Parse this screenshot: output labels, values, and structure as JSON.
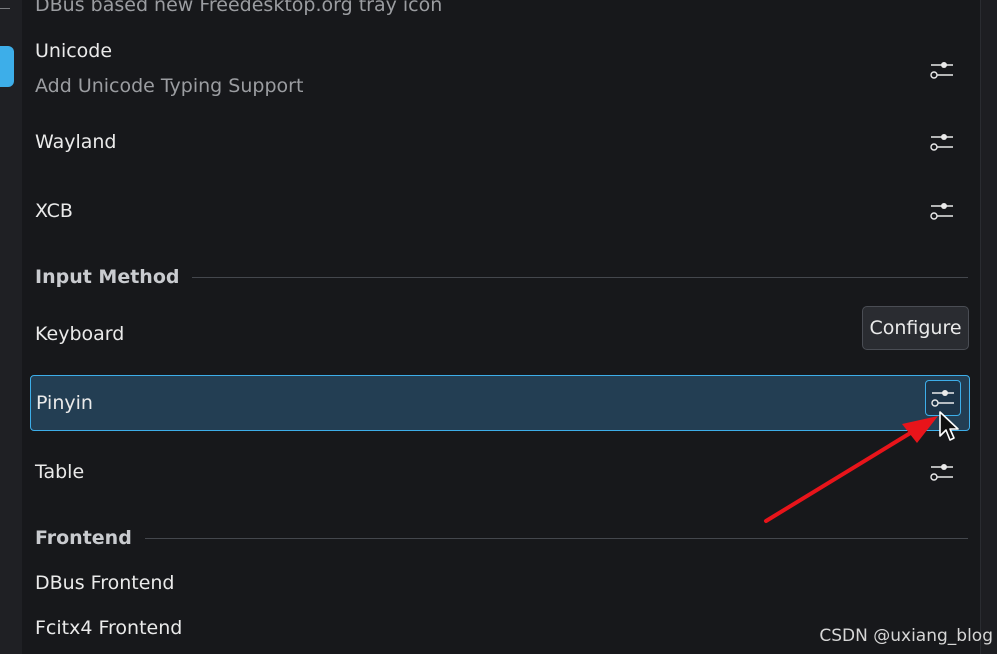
{
  "top_cut_description": "DBus based new Freedesktop.org tray icon",
  "addons": [
    {
      "name": "Unicode",
      "description": "Add Unicode Typing Support",
      "icon": "configure-icon"
    },
    {
      "name": "Wayland",
      "icon": "configure-icon"
    },
    {
      "name": "XCB",
      "icon": "configure-icon"
    }
  ],
  "input_method_section": {
    "title": "Input Method",
    "items": [
      {
        "name": "Keyboard"
      },
      {
        "name": "Pinyin",
        "selected": true,
        "icon": "configure-icon"
      },
      {
        "name": "Table",
        "icon": "configure-icon"
      }
    ]
  },
  "tooltip": "Configure",
  "frontend_section": {
    "title": "Frontend",
    "items": [
      {
        "name": "DBus Frontend"
      },
      {
        "name": "Fcitx4 Frontend"
      }
    ]
  },
  "annotation": {
    "arrow_color": "#e8141a",
    "cursor": "mouse-pointer"
  },
  "watermark": "CSDN @uxiang_blog",
  "colors": {
    "accent": "#3daee9",
    "selection_bg": "#233e53",
    "background": "#17181b"
  }
}
